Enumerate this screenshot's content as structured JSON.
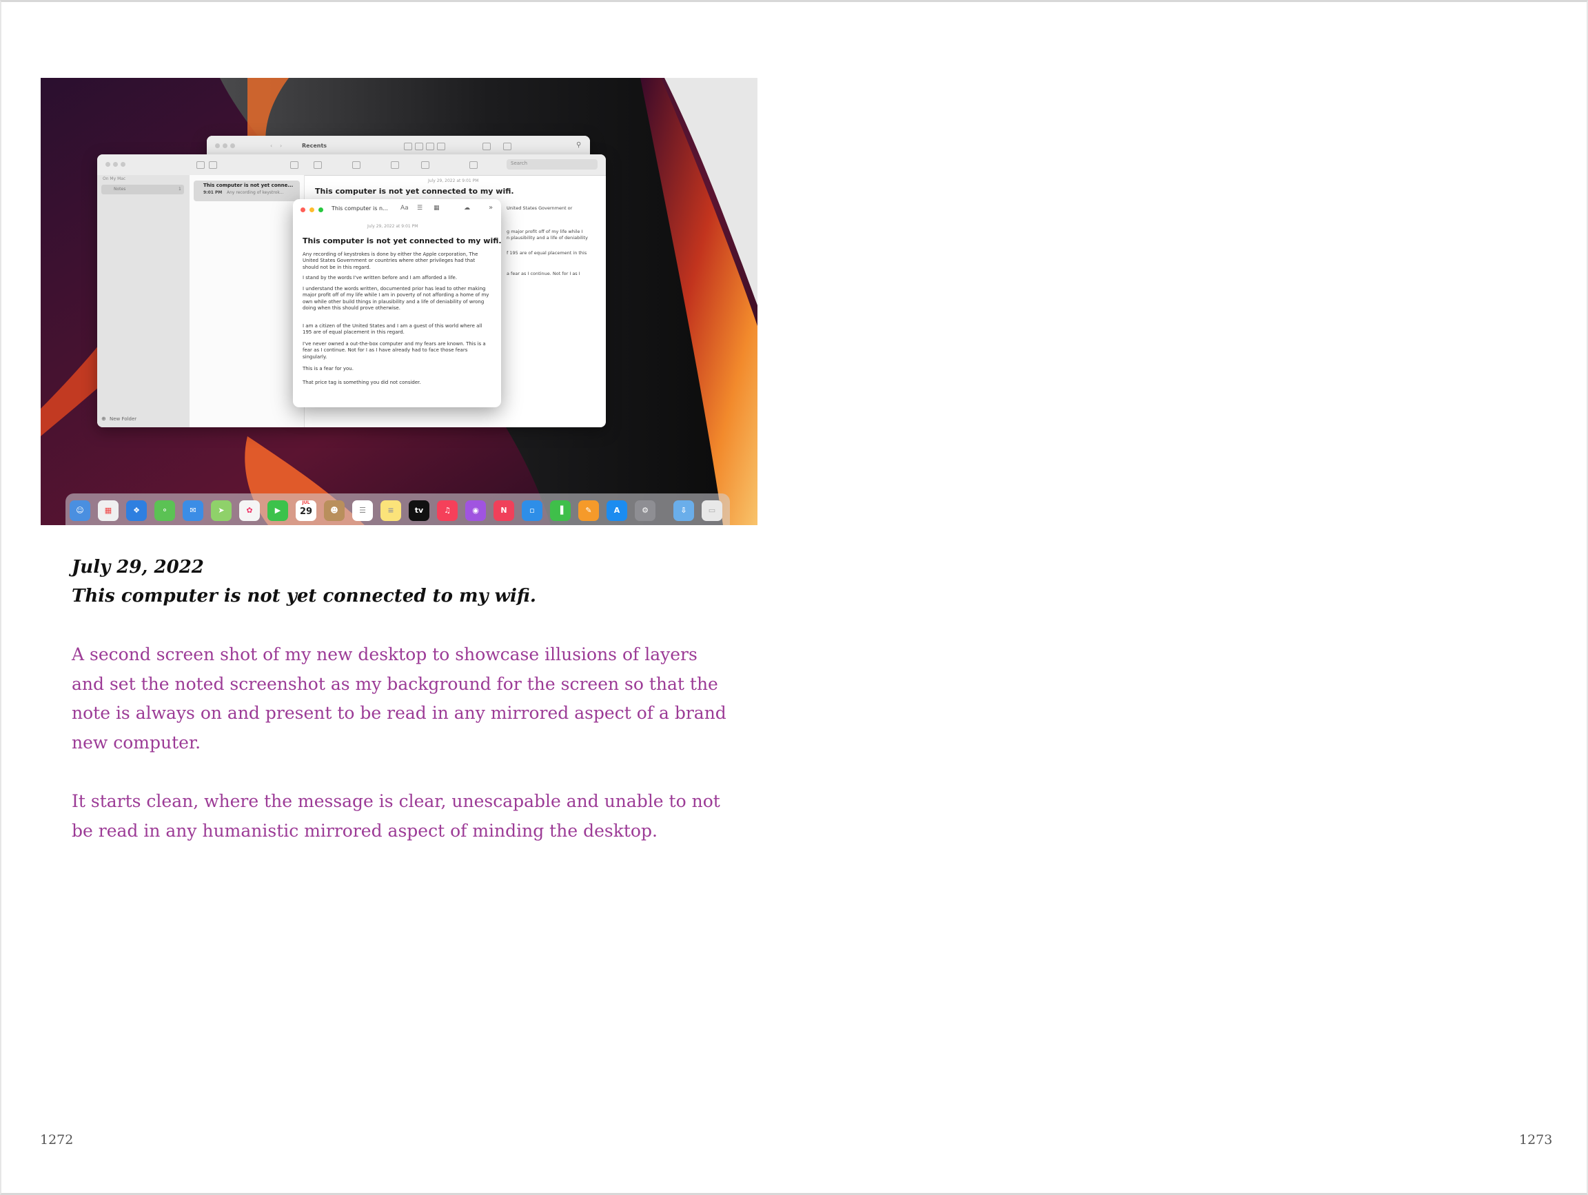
{
  "screenshot": {
    "finder": {
      "title": "Recents",
      "search_placeholder": "Search"
    },
    "notes": {
      "sidebar_section": "On My Mac",
      "sidebar_folder": "Notes",
      "sidebar_count": "1",
      "new_folder": "New Folder",
      "list_item_title": "This computer is not yet conne...",
      "list_item_time": "9:01 PM",
      "list_item_preview": "Any recording of keystrok...",
      "note_date": "July 29, 2022 at 9:01 PM",
      "note_title": "This computer is not yet connected to my wifi.",
      "peek_lines": [
        "United States Government or",
        "g major profit off of my life while I",
        "n plausibility and a life of deniability",
        "f 195 are of equal placement in this",
        "a fear as I continue. Not for I as I"
      ]
    },
    "popup": {
      "title": "This computer is n...",
      "date": "July 29, 2022 at 9:01 PM",
      "heading": "This computer is not yet connected to my wifi.",
      "paragraphs": [
        "Any recording of keystrokes is done by either the Apple corporation, The United States Government or countries where other privileges had that should not be in this regard.",
        "I stand by the words I've written before and I am afforded a life.",
        "I understand the words written, documented prior has lead to other making major profit off of my life while I am in poverty of not affording a home of my own while other build things in plausibility and a life of deniability of wrong doing when this should prove otherwise.",
        "I am a citizen of the United States and I am a guest of this world where all 195 are of equal placement in this regard.",
        "I've never owned a out-the-box computer and my fears are known. This is a fear as I continue. Not for I as I have already had to face those fears singularly.",
        "This is a fear for you.",
        "That price tag is something you did not consider."
      ]
    },
    "dock": {
      "calendar_month": "JUL",
      "calendar_day": "29",
      "tv_label": "tv"
    }
  },
  "caption": {
    "date": "July 29, 2022",
    "title": "This computer is not yet connected to my wifi."
  },
  "body": {
    "paragraph1": "A second screen shot of my new desktop to showcase illusions of layers and set the noted screenshot as my background for the screen so that the note is always on and present to be read in any mirrored aspect of a brand new computer.",
    "paragraph2": "It starts clean, where the message is clear, unescapable and unable to not be read in any humanistic mirrored aspect of minding the desktop."
  },
  "folio": {
    "left": "1272",
    "right": "1273"
  },
  "colors": {
    "body_text": "#9c3b96",
    "caption_text": "#111111"
  }
}
